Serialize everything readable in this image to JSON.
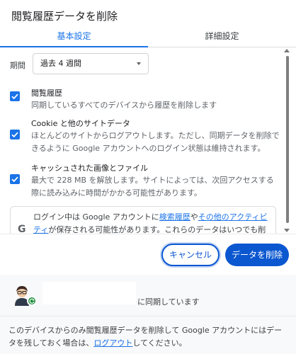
{
  "dialog": {
    "title": "閲覧履歴データを削除"
  },
  "tabs": [
    {
      "label": "基本設定",
      "active": true
    },
    {
      "label": "詳細設定",
      "active": false
    }
  ],
  "period": {
    "label": "期間",
    "value": "過去 4 週間"
  },
  "options": [
    {
      "title": "閲覧履歴",
      "desc": "同期しているすべてのデバイスから履歴を削除します",
      "checked": true
    },
    {
      "title": "Cookie と他のサイトデータ",
      "desc": "ほとんどのサイトからログアウトします。ただし、同期データを削除できるように Google アカウントへのログイン状態は維持されます。",
      "checked": true
    },
    {
      "title": "キャッシュされた画像とファイル",
      "desc": "最大で 228 MB を解放します。サイトによっては、次回アクセスする際に読み込みに時間がかかる可能性があります。",
      "checked": true
    }
  ],
  "info": {
    "text_before": "ログイン中は Google アカウントに",
    "link1": "検索履歴",
    "text_mid": "や",
    "link2": "その他のアクティビティ",
    "text_after": "が保存される可能性があります。これらのデータはいつでも削除で"
  },
  "buttons": {
    "cancel": "キャンセル",
    "delete": "データを削除"
  },
  "account": {
    "sync_text": "に同期しています"
  },
  "footer": {
    "text_before": "このデバイスからのみ閲覧履歴データを削除して Google アカウントにはデータを残しておく場合は、",
    "link": "ログアウト",
    "text_after": "してください。"
  },
  "colors": {
    "accent": "#1a73e8",
    "primary_button": "#0b57d0",
    "sync_badge": "#1e8e3e"
  }
}
